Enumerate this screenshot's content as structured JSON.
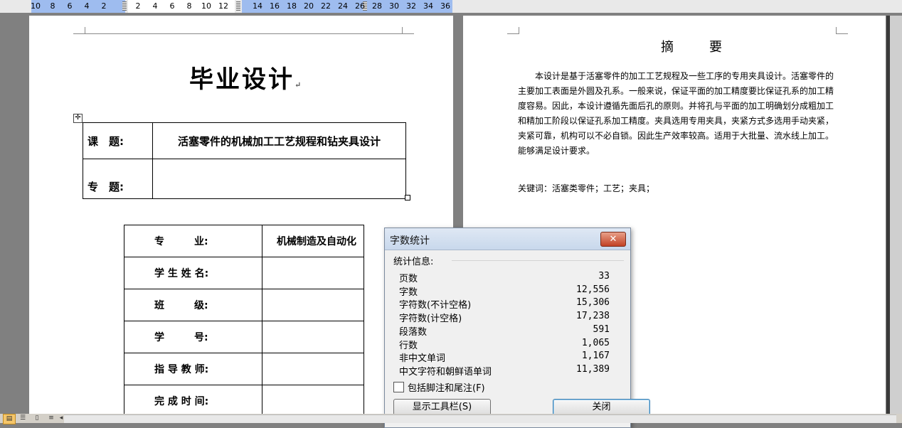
{
  "ruler": {
    "ticks": [
      "10",
      "8",
      "6",
      "4",
      "2",
      "2",
      "4",
      "6",
      "8",
      "10",
      "12",
      "14",
      "16",
      "18",
      "20",
      "22",
      "24",
      "26",
      "28",
      "30",
      "32",
      "34",
      "36"
    ]
  },
  "left_page": {
    "title": "毕业设计",
    "topic_table": [
      {
        "label": "课　题:",
        "value": "活塞零件的机械加工工艺规程和钻夹具设计"
      },
      {
        "label": "专　题:",
        "value": ""
      }
    ],
    "info_table": [
      {
        "label": "专　　　业:",
        "value": "机械制造及自动化"
      },
      {
        "label": "学 生 姓 名:",
        "value": ""
      },
      {
        "label": "班　　　级:",
        "value": ""
      },
      {
        "label": "学　　　号:",
        "value": ""
      },
      {
        "label": "指 导 教 师:",
        "value": ""
      },
      {
        "label": "完 成 时 间:",
        "value": ""
      }
    ],
    "para_mark": "↵"
  },
  "right_page": {
    "abstract_title": "摘　要",
    "abstract_body": "　　本设计是基于活塞零件的加工工艺规程及一些工序的专用夹具设计。活塞零件的主要加工表面是外圆及孔系。一般来说，保证平面的加工精度要比保证孔系的加工精度容易。因此，本设计遵循先面后孔的原则。并将孔与平面的加工明确划分成粗加工和精加工阶段以保证孔系加工精度。夹具选用专用夹具，夹紧方式多选用手动夹紧，夹紧可靠，机构可以不必自锁。因此生产效率较高。适用于大批量、流水线上加工。能够满足设计要求。",
    "keywords": "关键词：活塞类零件；工艺；夹具；"
  },
  "dialog": {
    "title": "字数统计",
    "close_glyph": "✕",
    "stats_heading": "统计信息:",
    "stats": [
      {
        "name": "页数",
        "value": "33"
      },
      {
        "name": "字数",
        "value": "12,556"
      },
      {
        "name": "字符数(不计空格)",
        "value": "15,306"
      },
      {
        "name": "字符数(计空格)",
        "value": "17,238"
      },
      {
        "name": "段落数",
        "value": "591"
      },
      {
        "name": "行数",
        "value": "1,065"
      },
      {
        "name": "非中文单词",
        "value": "1,167"
      },
      {
        "name": "中文字符和朝鲜语单词",
        "value": "11,389"
      }
    ],
    "checkbox_label": "包括脚注和尾注(F)",
    "checkbox_checked": false,
    "toolbar_button": "显示工具栏(S)",
    "close_button": "关闭"
  },
  "colors": {
    "ruler_blue": "#9ebcef",
    "close_red": "#c24225"
  }
}
